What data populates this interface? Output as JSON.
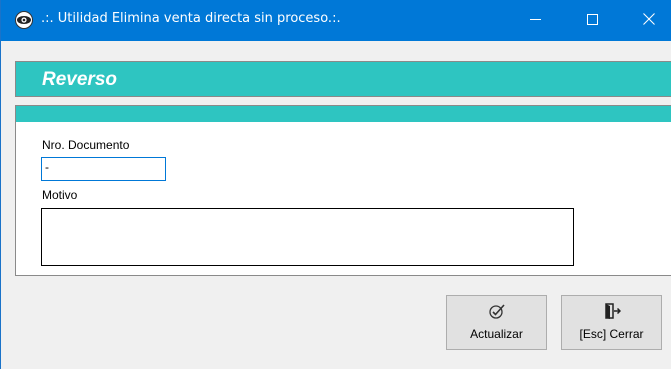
{
  "window": {
    "title": ".:. Utilidad Elimina venta directa sin proceso.:.",
    "app_icon": "eye-icon",
    "controls": [
      "minimize-icon",
      "maximize-icon",
      "close-icon"
    ]
  },
  "banner": {
    "title": "Reverso",
    "color": "#2ec5c1"
  },
  "form": {
    "doc_label": "Nro. Documento",
    "doc_value": "-",
    "motivo_label": "Motivo",
    "motivo_value": ""
  },
  "buttons": {
    "update_label": "Actualizar",
    "update_icon": "check-badge-icon",
    "close_label": "[Esc] Cerrar",
    "close_icon": "exit-door-icon"
  },
  "colors": {
    "titlebar": "#0078d7",
    "accent": "#2ec5c1"
  }
}
